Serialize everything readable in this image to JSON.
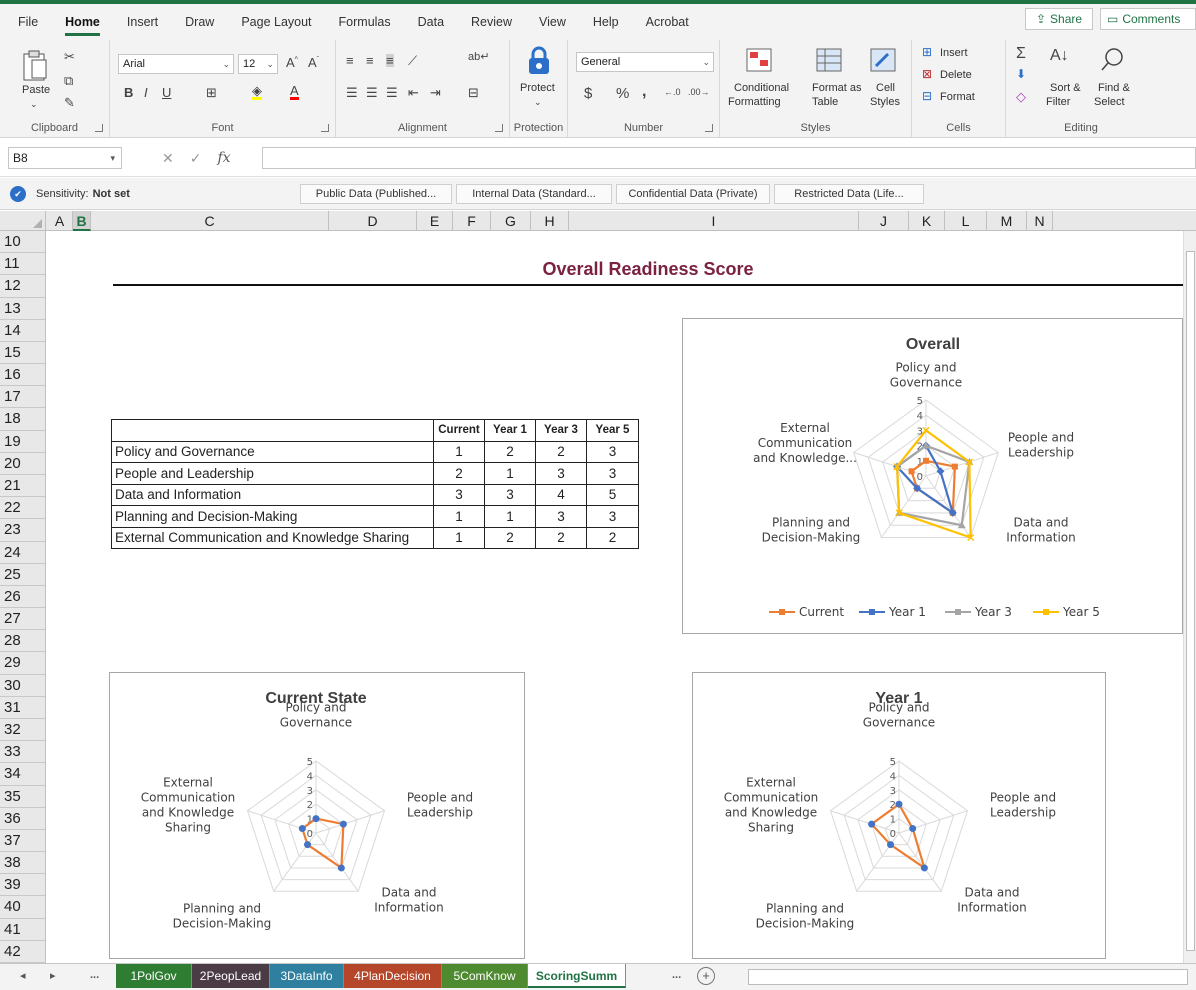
{
  "menu": {
    "tabs": [
      "File",
      "Home",
      "Insert",
      "Draw",
      "Page Layout",
      "Formulas",
      "Data",
      "Review",
      "View",
      "Help",
      "Acrobat"
    ],
    "active": "Home",
    "share": "Share",
    "comments": "Comments"
  },
  "ribbon": {
    "clipboard": {
      "label": "Clipboard",
      "paste": "Paste"
    },
    "font": {
      "label": "Font",
      "name": "Arial",
      "size": "12"
    },
    "alignment": {
      "label": "Alignment"
    },
    "protection": {
      "label": "Protection",
      "protect": "Protect"
    },
    "number": {
      "label": "Number",
      "format": "General"
    },
    "styles": {
      "label": "Styles",
      "conditional1": "Conditional",
      "conditional2": "Formatting",
      "formatas1": "Format as",
      "formatas2": "Table",
      "cell1": "Cell",
      "cell2": "Styles"
    },
    "cells": {
      "label": "Cells",
      "insert": "Insert",
      "delete": "Delete",
      "format": "Format"
    },
    "editing": {
      "label": "Editing",
      "sort1": "Sort &",
      "sort2": "Filter",
      "find1": "Find &",
      "find2": "Select"
    }
  },
  "formula_bar": {
    "name_box": "B8",
    "fx": "fx",
    "value": ""
  },
  "sensitivity": {
    "label": "Sensitivity:",
    "value": "Not set",
    "options": [
      "Public Data (Published...",
      "Internal Data (Standard...",
      "Confidential Data (Private)",
      "Restricted Data (Life..."
    ]
  },
  "columns": [
    "A",
    "B",
    "C",
    "D",
    "E",
    "F",
    "G",
    "H",
    "I",
    "J",
    "K",
    "L",
    "M",
    "N"
  ],
  "selected_column": "B",
  "rows": [
    "10",
    "11",
    "12",
    "13",
    "14",
    "15",
    "16",
    "17",
    "18",
    "19",
    "20",
    "21",
    "22",
    "23",
    "24",
    "25",
    "26",
    "27",
    "28",
    "29",
    "30",
    "31",
    "32",
    "33",
    "34",
    "35",
    "36",
    "37",
    "38",
    "39",
    "40",
    "41",
    "42"
  ],
  "sheet": {
    "title": "Overall Readiness Score",
    "table": {
      "headers": [
        "",
        "Current",
        "Year 1",
        "Year 3",
        "Year 5"
      ],
      "rows": [
        {
          "label": "Policy and Governance",
          "values": [
            "1",
            "2",
            "2",
            "3"
          ]
        },
        {
          "label": "People and Leadership",
          "values": [
            "2",
            "1",
            "3",
            "3"
          ]
        },
        {
          "label": "Data and Information",
          "values": [
            "3",
            "3",
            "4",
            "5"
          ]
        },
        {
          "label": "Planning and Decision-Making",
          "values": [
            "1",
            "1",
            "3",
            "3"
          ]
        },
        {
          "label": "External Communication and Knowledge Sharing",
          "values": [
            "1",
            "2",
            "2",
            "2"
          ]
        }
      ]
    }
  },
  "chart_data": [
    {
      "type": "radar",
      "title": "Overall",
      "categories": [
        "Policy and Governance",
        "People and Leadership",
        "Data and Information",
        "Planning and Decision-Making",
        "External Communication and Knowledge..."
      ],
      "range": [
        0,
        5
      ],
      "ticks": [
        "5",
        "4",
        "3",
        "2",
        "1",
        "0"
      ],
      "series": [
        {
          "name": "Current",
          "values": [
            1,
            2,
            3,
            1,
            1
          ],
          "color": "#ed7d31",
          "marker": "square"
        },
        {
          "name": "Year 1",
          "values": [
            2,
            1,
            3,
            1,
            2
          ],
          "color": "#4472c4",
          "marker": "diamond"
        },
        {
          "name": "Year 3",
          "values": [
            2,
            3,
            4,
            3,
            2
          ],
          "color": "#a5a5a5",
          "marker": "triangle"
        },
        {
          "name": "Year 5",
          "values": [
            3,
            3,
            5,
            3,
            2
          ],
          "color": "#ffc000",
          "marker": "x"
        }
      ],
      "legend": "bottom"
    },
    {
      "type": "radar",
      "title": "Current State",
      "categories": [
        "Policy and Governance",
        "People and Leadership",
        "Data and Information",
        "Planning and Decision-Making",
        "External Communication and Knowledge Sharing"
      ],
      "range": [
        0,
        5
      ],
      "ticks": [
        "5",
        "4",
        "3",
        "2",
        "1",
        "0"
      ],
      "series": [
        {
          "values": [
            1,
            2,
            3,
            1,
            1
          ],
          "color": "#ed7d31",
          "marker_color": "#4472c4"
        }
      ]
    },
    {
      "type": "radar",
      "title": "Year 1",
      "categories": [
        "Policy and Governance",
        "People and Leadership",
        "Data and Information",
        "Planning and Decision-Making",
        "External Communication and Knowledge Sharing"
      ],
      "range": [
        0,
        5
      ],
      "ticks": [
        "5",
        "4",
        "3",
        "2",
        "1",
        "0"
      ],
      "series": [
        {
          "values": [
            2,
            1,
            3,
            1,
            2
          ],
          "color": "#ed7d31",
          "marker_color": "#4472c4"
        }
      ]
    }
  ],
  "sheet_tabs": {
    "nav": [
      "◂",
      "▸",
      "..."
    ],
    "tabs": [
      {
        "name": "1PolGov",
        "color": "#2e7d32"
      },
      {
        "name": "2PeopLead",
        "color": "#4a3b45"
      },
      {
        "name": "3DataInfo",
        "color": "#2e7fa0"
      },
      {
        "name": "4PlanDecision",
        "color": "#b5462a"
      },
      {
        "name": "5ComKnow",
        "color": "#4e8a2f"
      },
      {
        "name": "ScoringSumm",
        "color": "#ffffff"
      }
    ],
    "active": "ScoringSumm",
    "more": "...",
    "add": "+"
  }
}
